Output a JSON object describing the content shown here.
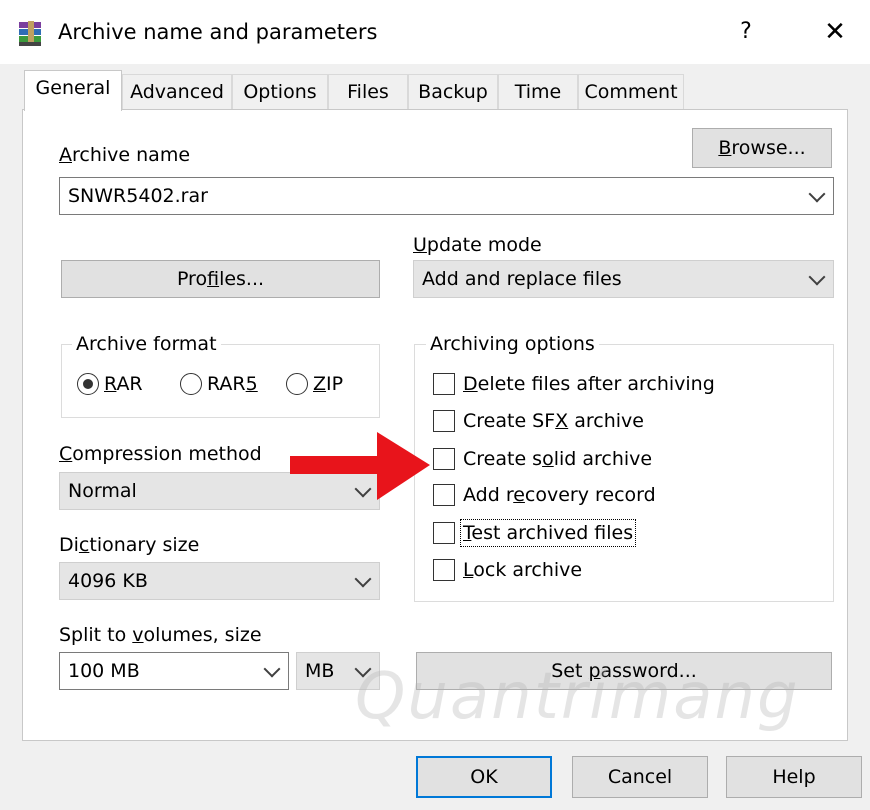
{
  "window": {
    "title": "Archive name and parameters",
    "help_label": "?",
    "close_label": "✕"
  },
  "tabs": [
    "General",
    "Advanced",
    "Options",
    "Files",
    "Backup",
    "Time",
    "Comment"
  ],
  "archive_name": {
    "label_first": "A",
    "label_rest": "rchive name",
    "value": "SNWR5402.rar",
    "browse_first": "B",
    "browse_rest": "rowse..."
  },
  "profiles_button": {
    "before": "Pro",
    "mnemonic": "f",
    "after": "iles..."
  },
  "update_mode": {
    "label_first": "U",
    "label_rest": "pdate mode",
    "value": "Add and replace files"
  },
  "archive_format": {
    "title": "Archive format",
    "options": [
      {
        "first": "R",
        "rest": "AR",
        "checked": true
      },
      {
        "before": "RAR",
        "mnemonic": "5",
        "checked": false
      },
      {
        "first": "Z",
        "rest": "IP",
        "checked": false
      }
    ]
  },
  "compression_method": {
    "label_first": "C",
    "label_rest": "ompression method",
    "value": "Normal"
  },
  "dictionary_size": {
    "label_before": "Di",
    "label_mnemonic": "c",
    "label_after": "tionary size",
    "value": "4096 KB"
  },
  "split_volumes": {
    "label_before": "Split to ",
    "label_mnemonic": "v",
    "label_after": "olumes, size",
    "value": "100 MB",
    "unit": "MB"
  },
  "set_password_button": {
    "before": "Set ",
    "mnemonic": "p",
    "after": "assword..."
  },
  "archiving_options": {
    "title": "Archiving options",
    "items": [
      {
        "first": "D",
        "rest": "elete files after archiving",
        "checked": false
      },
      {
        "before": "Create SF",
        "mnemonic": "X",
        "after": " archive",
        "checked": false
      },
      {
        "before": "Create s",
        "mnemonic": "o",
        "after": "lid archive",
        "checked": false
      },
      {
        "before": "Add r",
        "mnemonic": "e",
        "after": "covery record",
        "checked": false
      },
      {
        "first": "T",
        "rest": "est archived files",
        "checked": false
      },
      {
        "first": "L",
        "rest": "ock archive",
        "checked": false
      }
    ]
  },
  "footer": {
    "ok": "OK",
    "cancel": "Cancel",
    "help": "Help"
  },
  "colors": {
    "accent": "#0078d7",
    "arrow": "#e8141b"
  },
  "watermark": "Quantrimang"
}
